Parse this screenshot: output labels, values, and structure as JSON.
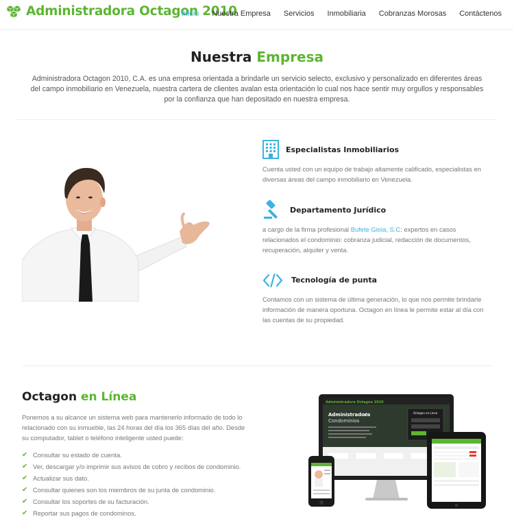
{
  "brand": {
    "name": "Administradora Octagon 2010",
    "color": "#5cb531"
  },
  "nav": {
    "items": [
      "Inicio",
      "Nuestra Empresa",
      "Servicios",
      "Inmobiliaria",
      "Cobranzas Morosas",
      "Contáctenos"
    ],
    "active_color": "#3bb3e0"
  },
  "empresa": {
    "title_part1": "Nuestra",
    "title_part2": "Empresa",
    "intro": "Administradora Octagon 2010, C.A. es una empresa orientada a brindarle un servicio selecto, exclusivo y personalizado en diferentes áreas del campo inmobiliario en Venezuela, nuestra cartera de clientes avalan esta orientación lo cual nos hace sentir muy orgullos y responsables por la confianza que han depositado en nuestra empresa."
  },
  "features": [
    {
      "icon": "building-icon",
      "title": "Especialistas Inmobiliarios",
      "text": "Cuenta usted con un equipo de trabajo altamente calificado, especialistas en diversas áreas del campo inmobiliario en Venezuela."
    },
    {
      "icon": "gavel-icon",
      "title": "Departamento Jurídico",
      "text_before": "a cargo de la firma profesional ",
      "link": "Bufete Gioia, S.C",
      "text_after": ": expertos en casos relacionados el condominio: cobranza judicial, redacción de documentos, recuperación, alquiler y venta."
    },
    {
      "icon": "code-icon",
      "title": "Tecnología de punta",
      "text": "Contamos con un sistema de última generación, lo que nos permite brindarle información de manera oportuna. Octagon en línea le permite estar al día con las cuentas de su propiedad."
    }
  ],
  "online": {
    "title_part1": "Octagon",
    "title_part2": "en Línea",
    "description": "Ponemos a su alcance un sistema web para mantenerlo informado de todo lo relacionado con su inmueble, las 24 horas del día los 365 días del año. Desde su computador, tablet o teléfono inteligente usted puede:",
    "checklist": [
      "Consultar su estado de cuenta.",
      "Ver, descargar y/o imprimir sus avisos de cobro y recibos de condominio.",
      "Actualizar sus dato.",
      "Consultar quienes son los miembros de su junta de condominio.",
      "Consultar los soportes de su facturación.",
      "Reportar sus pagos de condominos."
    ]
  },
  "devices_screen": {
    "monitor_header": "Administradora Octagon 2010",
    "monitor_title1": "Administradora",
    "monitor_title2": "de",
    "monitor_title3": "Condominios",
    "login_title": "Octagon en Linea"
  }
}
